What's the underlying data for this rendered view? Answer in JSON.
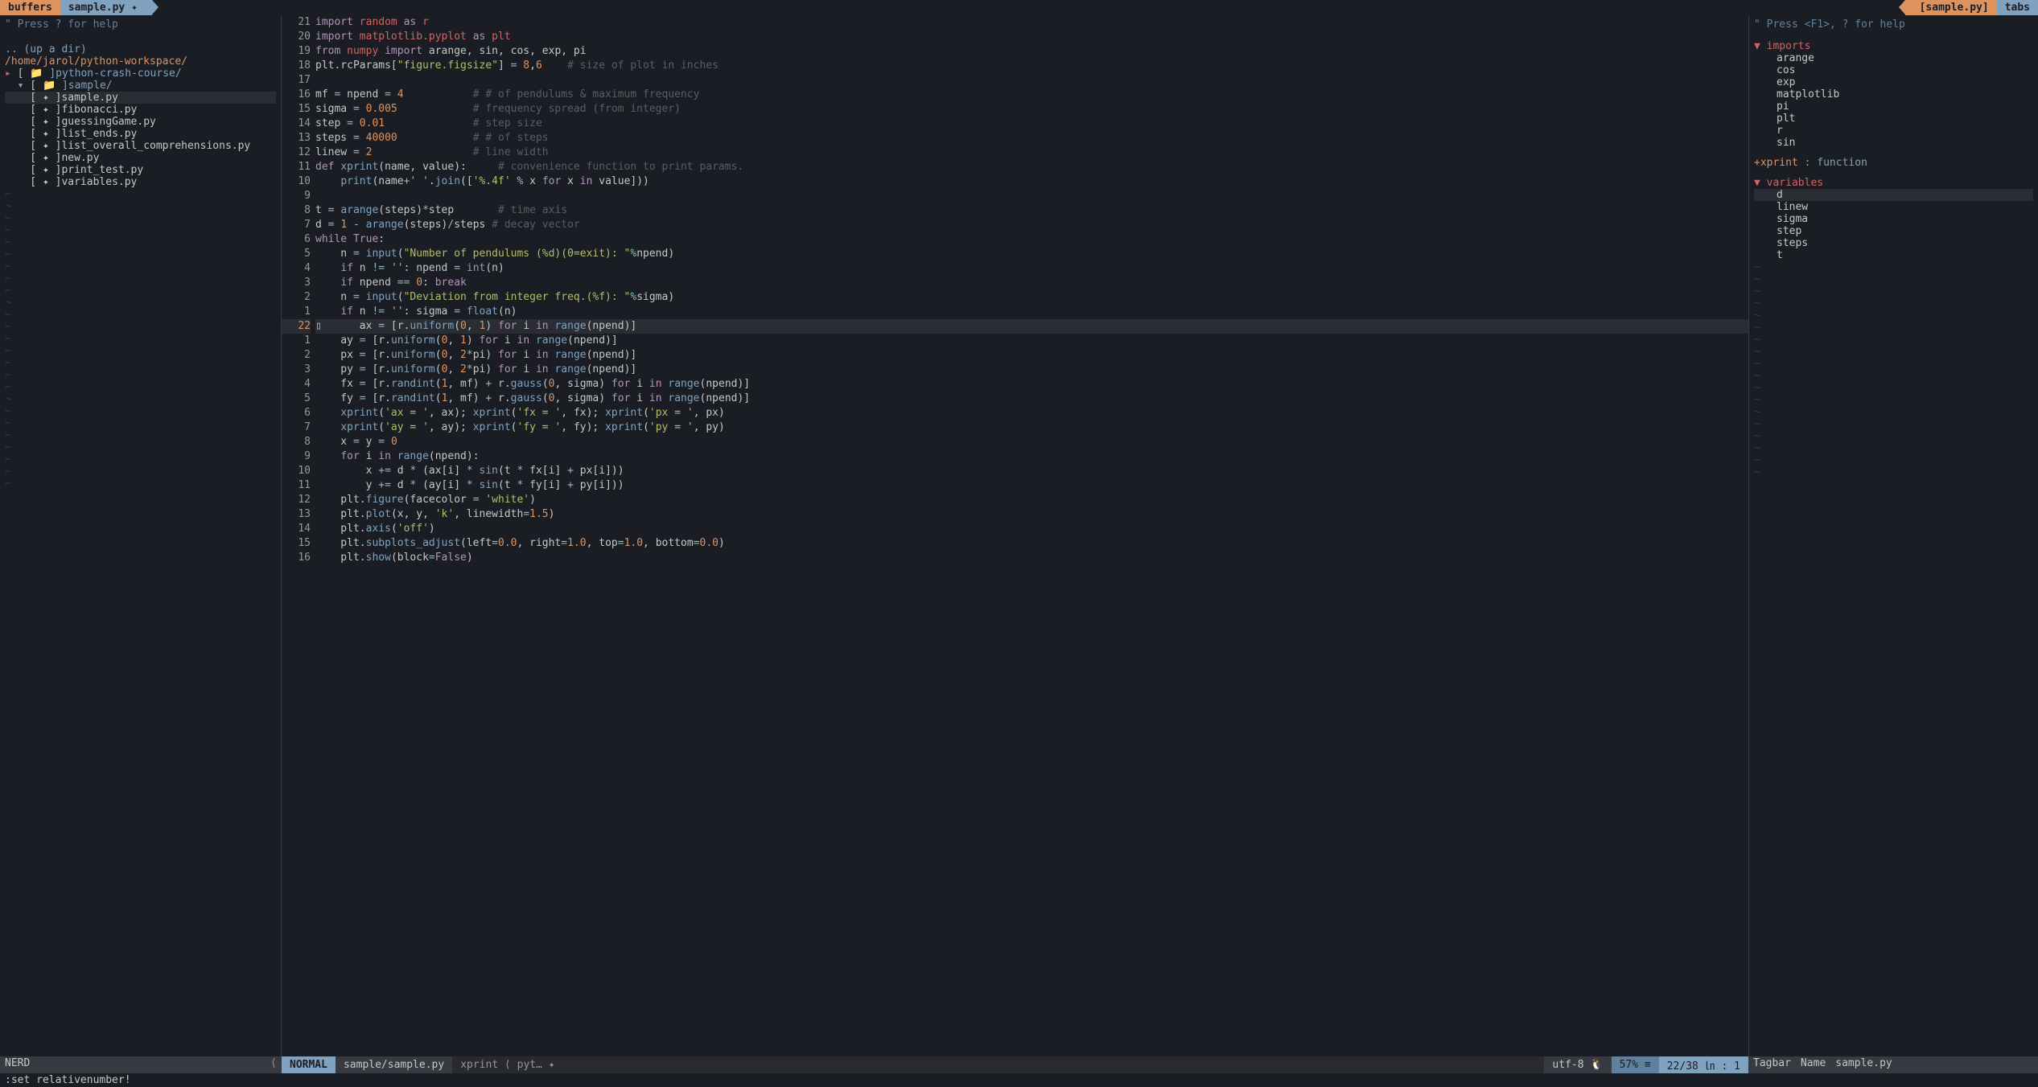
{
  "tabs": {
    "buffers": "buffers",
    "file": "sample.py ✦",
    "right_file": "[sample.py]",
    "tabs_label": "tabs"
  },
  "nerdtree": {
    "hint": "\" Press ? for help",
    "updir": ".. (up a dir)",
    "path": "/home/jarol/python-workspace/",
    "folders": [
      {
        "caret": "▸",
        "name": "]python-crash-course/",
        "open": false
      },
      {
        "caret": "▾",
        "name": "]sample/",
        "open": true
      }
    ],
    "files": [
      {
        "name": "]sample.py",
        "active": true
      },
      {
        "name": "]fibonacci.py",
        "active": false
      },
      {
        "name": "]guessingGame.py",
        "active": false
      },
      {
        "name": "]list_ends.py",
        "active": false
      },
      {
        "name": "]list_overall_comprehensions.py",
        "active": false
      },
      {
        "name": "]new.py",
        "active": false
      },
      {
        "name": "]print_test.py",
        "active": false
      },
      {
        "name": "]variables.py",
        "active": false
      }
    ]
  },
  "code": {
    "line_numbers": [
      "21",
      "20",
      "19",
      "18",
      "17",
      "16",
      "15",
      "14",
      "13",
      "12",
      "11",
      "10",
      "9",
      "8",
      "7",
      "6",
      "5",
      "4",
      "3",
      "2",
      "1",
      "22",
      "1",
      "2",
      "3",
      "4",
      "5",
      "6",
      "7",
      "8",
      "9",
      "10",
      "11",
      "12",
      "13",
      "14",
      "15",
      "16"
    ],
    "cursor_index": 21,
    "lines_html": [
      "<span class='kw'>import</span> <span class='id'>random</span> <span class='kw'>as</span> <span class='id'>r</span>",
      "<span class='kw'>import</span> <span class='id'>matplotlib.pyplot</span> <span class='kw'>as</span> <span class='id'>plt</span>",
      "<span class='kw'>from</span> <span class='id'>numpy</span> <span class='kw'>import</span> arange, sin, cos, exp, pi",
      "plt.rcParams[<span class='str'>\"figure.figsize\"</span>] <span class='op'>=</span> <span class='num'>8</span>,<span class='num'>6</span>    <span class='cm'># size of plot in inches</span>",
      "",
      "mf <span class='op'>=</span> npend <span class='op'>=</span> <span class='num'>4</span>           <span class='cm'># # of pendulums &amp; maximum frequency</span>",
      "sigma <span class='op'>=</span> <span class='num'>0.005</span>            <span class='cm'># frequency spread (from integer)</span>",
      "step <span class='op'>=</span> <span class='num'>0.01</span>              <span class='cm'># step size</span>",
      "steps <span class='op'>=</span> <span class='num'>40000</span>            <span class='cm'># # of steps</span>",
      "linew <span class='op'>=</span> <span class='num'>2</span>                <span class='cm'># line width</span>",
      "<span class='kw'>def</span> <span class='fn'>xprint</span>(name, value):     <span class='cm'># convenience function to print params.</span>",
      "    <span class='fn'>print</span>(name<span class='op'>+</span><span class='str'>' '</span>.<span class='fn'>join</span>([<span class='str'>'%.4f'</span> <span class='op'>%</span> x <span class='kw'>for</span> x <span class='kw'>in</span> value]))",
      "",
      "t <span class='op'>=</span> <span class='fn'>arange</span>(steps)<span class='op'>*</span>step       <span class='cm'># time axis</span>",
      "d <span class='op'>=</span> <span class='num'>1</span> <span class='op'>-</span> <span class='fn'>arange</span>(steps)<span class='op'>/</span>steps <span class='cm'># decay vector</span>",
      "<span class='kw'>while</span> <span class='kw'>True</span>:",
      "    n <span class='op'>=</span> <span class='fn'>input</span>(<span class='str'>\"Number of pendulums (%d)(0=exit): \"</span><span class='op'>%</span>npend)",
      "    <span class='kw'>if</span> n <span class='op'>!=</span> <span class='str'>''</span>: npend <span class='op'>=</span> <span class='fn'>int</span>(n)",
      "    <span class='kw'>if</span> npend <span class='op'>==</span> <span class='num'>0</span>: <span class='kw'>break</span>",
      "    n <span class='op'>=</span> <span class='fn'>input</span>(<span class='str'>\"Deviation from integer freq.(%f): \"</span><span class='op'>%</span>sigma)",
      "    <span class='kw'>if</span> n <span class='op'>!=</span> <span class='str'>''</span>: sigma <span class='op'>=</span> <span class='fn'>float</span>(n)",
      "    ax <span class='op'>=</span> [r.<span class='fn'>uniform</span>(<span class='num'>0</span>, <span class='num'>1</span>) <span class='kw'>for</span> i <span class='kw'>in</span> <span class='fn'>range</span>(npend)]",
      "    ay <span class='op'>=</span> [r.<span class='fn'>uniform</span>(<span class='num'>0</span>, <span class='num'>1</span>) <span class='kw'>for</span> i <span class='kw'>in</span> <span class='fn'>range</span>(npend)]",
      "    px <span class='op'>=</span> [r.<span class='fn'>uniform</span>(<span class='num'>0</span>, <span class='num'>2</span><span class='op'>*</span>pi) <span class='kw'>for</span> i <span class='kw'>in</span> <span class='fn'>range</span>(npend)]",
      "    py <span class='op'>=</span> [r.<span class='fn'>uniform</span>(<span class='num'>0</span>, <span class='num'>2</span><span class='op'>*</span>pi) <span class='kw'>for</span> i <span class='kw'>in</span> <span class='fn'>range</span>(npend)]",
      "    fx <span class='op'>=</span> [r.<span class='fn'>randint</span>(<span class='num'>1</span>, mf) <span class='op'>+</span> r.<span class='fn'>gauss</span>(<span class='num'>0</span>, sigma) <span class='kw'>for</span> i <span class='kw'>in</span> <span class='fn'>range</span>(npend)]",
      "    fy <span class='op'>=</span> [r.<span class='fn'>randint</span>(<span class='num'>1</span>, mf) <span class='op'>+</span> r.<span class='fn'>gauss</span>(<span class='num'>0</span>, sigma) <span class='kw'>for</span> i <span class='kw'>in</span> <span class='fn'>range</span>(npend)]",
      "    <span class='fn'>xprint</span>(<span class='str'>'ax = '</span>, ax); <span class='fn'>xprint</span>(<span class='str'>'fx = '</span>, fx); <span class='fn'>xprint</span>(<span class='str'>'px = '</span>, px)",
      "    <span class='fn'>xprint</span>(<span class='str'>'ay = '</span>, ay); <span class='fn'>xprint</span>(<span class='str'>'fy = '</span>, fy); <span class='fn'>xprint</span>(<span class='str'>'py = '</span>, py)",
      "    x <span class='op'>=</span> y <span class='op'>=</span> <span class='num'>0</span>",
      "    <span class='kw'>for</span> i <span class='kw'>in</span> <span class='fn'>range</span>(npend):",
      "        x <span class='op'>+=</span> d <span class='op'>*</span> (ax[i] <span class='op'>*</span> <span class='fn'>sin</span>(t <span class='op'>*</span> fx[i] <span class='op'>+</span> px[i]))",
      "        y <span class='op'>+=</span> d <span class='op'>*</span> (ay[i] <span class='op'>*</span> <span class='fn'>sin</span>(t <span class='op'>*</span> fy[i] <span class='op'>+</span> py[i]))",
      "    plt.<span class='fn'>figure</span>(facecolor <span class='op'>=</span> <span class='str'>'white'</span>)",
      "    plt.<span class='fn'>plot</span>(x, y, <span class='str'>'k'</span>, linewidth<span class='op'>=</span><span class='num'>1.5</span>)",
      "    plt.<span class='fn'>axis</span>(<span class='str'>'off'</span>)",
      "    plt.<span class='fn'>subplots_adjust</span>(left<span class='op'>=</span><span class='num'>0.0</span>, right<span class='op'>=</span><span class='num'>1.0</span>, top<span class='op'>=</span><span class='num'>1.0</span>, bottom<span class='op'>=</span><span class='num'>0.0</span>)",
      "    plt.<span class='fn'>show</span>(block<span class='op'>=</span><span class='kw'>False</span>)"
    ]
  },
  "tagbar": {
    "hint": "\" Press <F1>, ? for help",
    "sections": [
      {
        "label": "imports",
        "items": [
          "arange",
          "cos",
          "exp",
          "matplotlib",
          "pi",
          "plt",
          "r",
          "sin"
        ]
      },
      {
        "label": "+xprint : function",
        "raw": true
      },
      {
        "label": "variables",
        "items": [
          "d",
          "linew",
          "sigma",
          "step",
          "steps",
          "t"
        ],
        "active": "d"
      }
    ]
  },
  "status": {
    "left": "NERD",
    "mode": "NORMAL",
    "file": "sample/sample.py",
    "func": "xprint ⟨ pyt… ✦",
    "enc": "utf-8 🐧",
    "pct": "57% ≡",
    "pos": "22/38 ㏑ :  1 ",
    "right_a": "Tagbar",
    "right_b": "Name",
    "right_c": "sample.py"
  },
  "cmdline": ":set relativenumber!"
}
